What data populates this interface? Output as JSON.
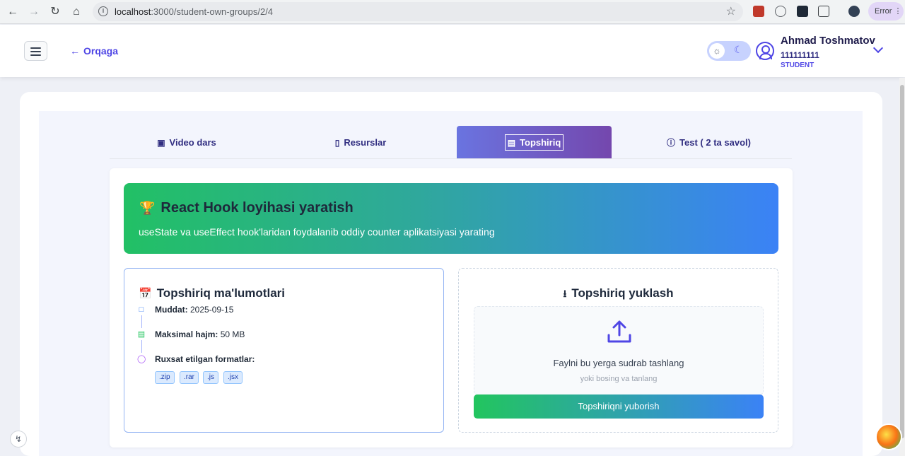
{
  "browser": {
    "url_host": "localhost",
    "url_path": ":3000/student-own-groups/2/4",
    "error_label": "Error"
  },
  "header": {
    "back_label": "Orqaga",
    "user_name": "Ahmad Toshmatov",
    "user_id": "111111111",
    "user_role": "STUDENT"
  },
  "tabs": [
    {
      "label": "Video dars",
      "icon": "video-icon"
    },
    {
      "label": "Resurslar",
      "icon": "book-icon"
    },
    {
      "label": "Topshiriq",
      "icon": "document-icon",
      "active": true
    },
    {
      "label": "Test ( 2 ta savol)",
      "icon": "help-circle-icon"
    }
  ],
  "task": {
    "title": "React Hook loyihasi yaratish",
    "description": "useState va useEffect hook'laridan foydalanib oddiy counter aplikatsiyasi yarating"
  },
  "info": {
    "title": "Topshiriq ma'lumotlari",
    "deadline_label": "Muddat:",
    "deadline_value": "2025-09-15",
    "size_label": "Maksimal hajm:",
    "size_value": "50 MB",
    "formats_label": "Ruxsat etilgan formatlar:",
    "formats": [
      ".zip",
      ".rar",
      ".js",
      ".jsx"
    ]
  },
  "upload": {
    "title": "Topshiriq yuklash",
    "drop_text": "Faylni bu yerga sudrab tashlang",
    "drop_sub": "yoki bosing va tanlang",
    "submit_label": "Topshiriqni yuborish"
  },
  "colors": {
    "accent": "#4f46e5",
    "banner_start": "#22c065",
    "banner_end": "#3b82f6",
    "tab_active_start": "#6a74e0",
    "tab_active_end": "#7447ad"
  }
}
